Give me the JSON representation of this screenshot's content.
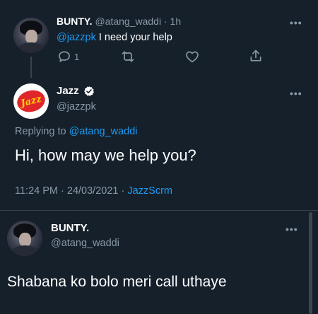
{
  "tweet1": {
    "name": "BUNTY.",
    "handle": "@atang_waddi",
    "sep": "·",
    "time": "1h",
    "mention": "@jazzpk",
    "text": " I need your help",
    "reply_count": "1"
  },
  "tweet2": {
    "name": "Jazz",
    "handle": "@jazzpk",
    "logo_text": "Jazz",
    "replying_prefix": "Replying to ",
    "replying_handle": "@atang_waddi",
    "text": "Hi, how may we help you?",
    "timestamp": "11:24 PM · 24/03/2021 · ",
    "source": "JazzScrm"
  },
  "tweet3": {
    "name": "BUNTY.",
    "handle": "@atang_waddi",
    "text": "Shabana ko bolo meri call uthaye"
  },
  "more_glyph": "•••",
  "colors": {
    "background": "#15202b",
    "accent": "#1d9bf0",
    "secondary_text": "#8899a6",
    "divider": "#38444d"
  }
}
